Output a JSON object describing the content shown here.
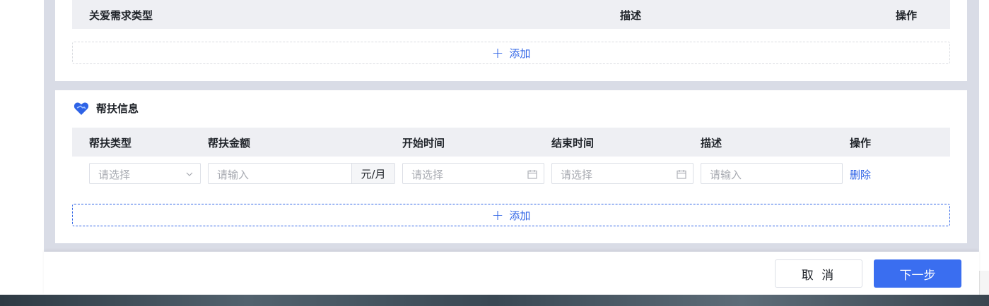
{
  "care_table": {
    "headers": [
      "关爱需求类型",
      "描述",
      "操作"
    ],
    "add_label": "添加"
  },
  "assist_section": {
    "title": "帮扶信息",
    "headers": [
      "帮扶类型",
      "帮扶金额",
      "开始时间",
      "结束时间",
      "描述",
      "操作"
    ],
    "row": {
      "type_placeholder": "请选择",
      "amount_placeholder": "请输入",
      "amount_unit": "元/月",
      "start_placeholder": "请选择",
      "end_placeholder": "请选择",
      "desc_placeholder": "请输入",
      "delete_label": "删除"
    },
    "add_label": "添加"
  },
  "footer": {
    "cancel_label": "取 消",
    "next_label": "下一步"
  },
  "colors": {
    "accent": "#2e63e6",
    "primary_button": "#3a6ef0",
    "header_bg": "#eeeff3",
    "page_bg": "#d9dce6"
  }
}
